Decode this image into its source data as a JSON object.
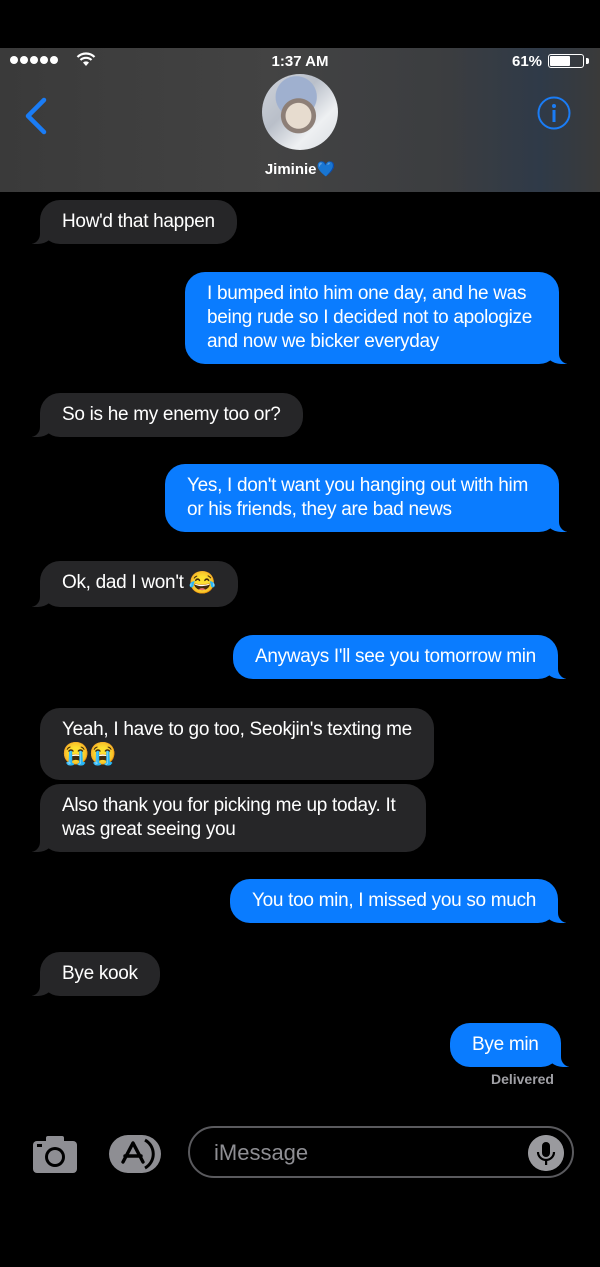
{
  "status_bar": {
    "time": "1:37 AM",
    "battery_percent": "61%",
    "battery_level": 0.61
  },
  "header": {
    "contact_name": "Jiminie💙"
  },
  "messages": [
    {
      "from": "them",
      "text": "How'd that happen"
    },
    {
      "from": "me",
      "text": "I bumped into him one day, and he was being rude so I decided not to apologize and now we bicker everyday"
    },
    {
      "from": "them",
      "text": "So is he my enemy too or?"
    },
    {
      "from": "me",
      "text": "Yes, I don't want you hanging out with him or his friends, they are bad news"
    },
    {
      "from": "them",
      "text": "Ok, dad I won't",
      "emoji": "😂"
    },
    {
      "from": "me",
      "text": "Anyways I'll see you tomorrow min"
    },
    {
      "from": "them",
      "text": "Yeah, I have to go too, Seokjin's texting me",
      "emoji": "😭😭"
    },
    {
      "from": "them",
      "text": "Also thank you for picking me up today. It was great seeing you"
    },
    {
      "from": "me",
      "text": "You too min, I missed you so much"
    },
    {
      "from": "them",
      "text": "Bye kook"
    },
    {
      "from": "me",
      "text": "Bye min"
    }
  ],
  "delivery_status": "Delivered",
  "compose": {
    "placeholder": "iMessage"
  },
  "colors": {
    "sent_bubble": "#0a7cff",
    "received_bubble": "#262628",
    "accent": "#1a7cf5"
  }
}
